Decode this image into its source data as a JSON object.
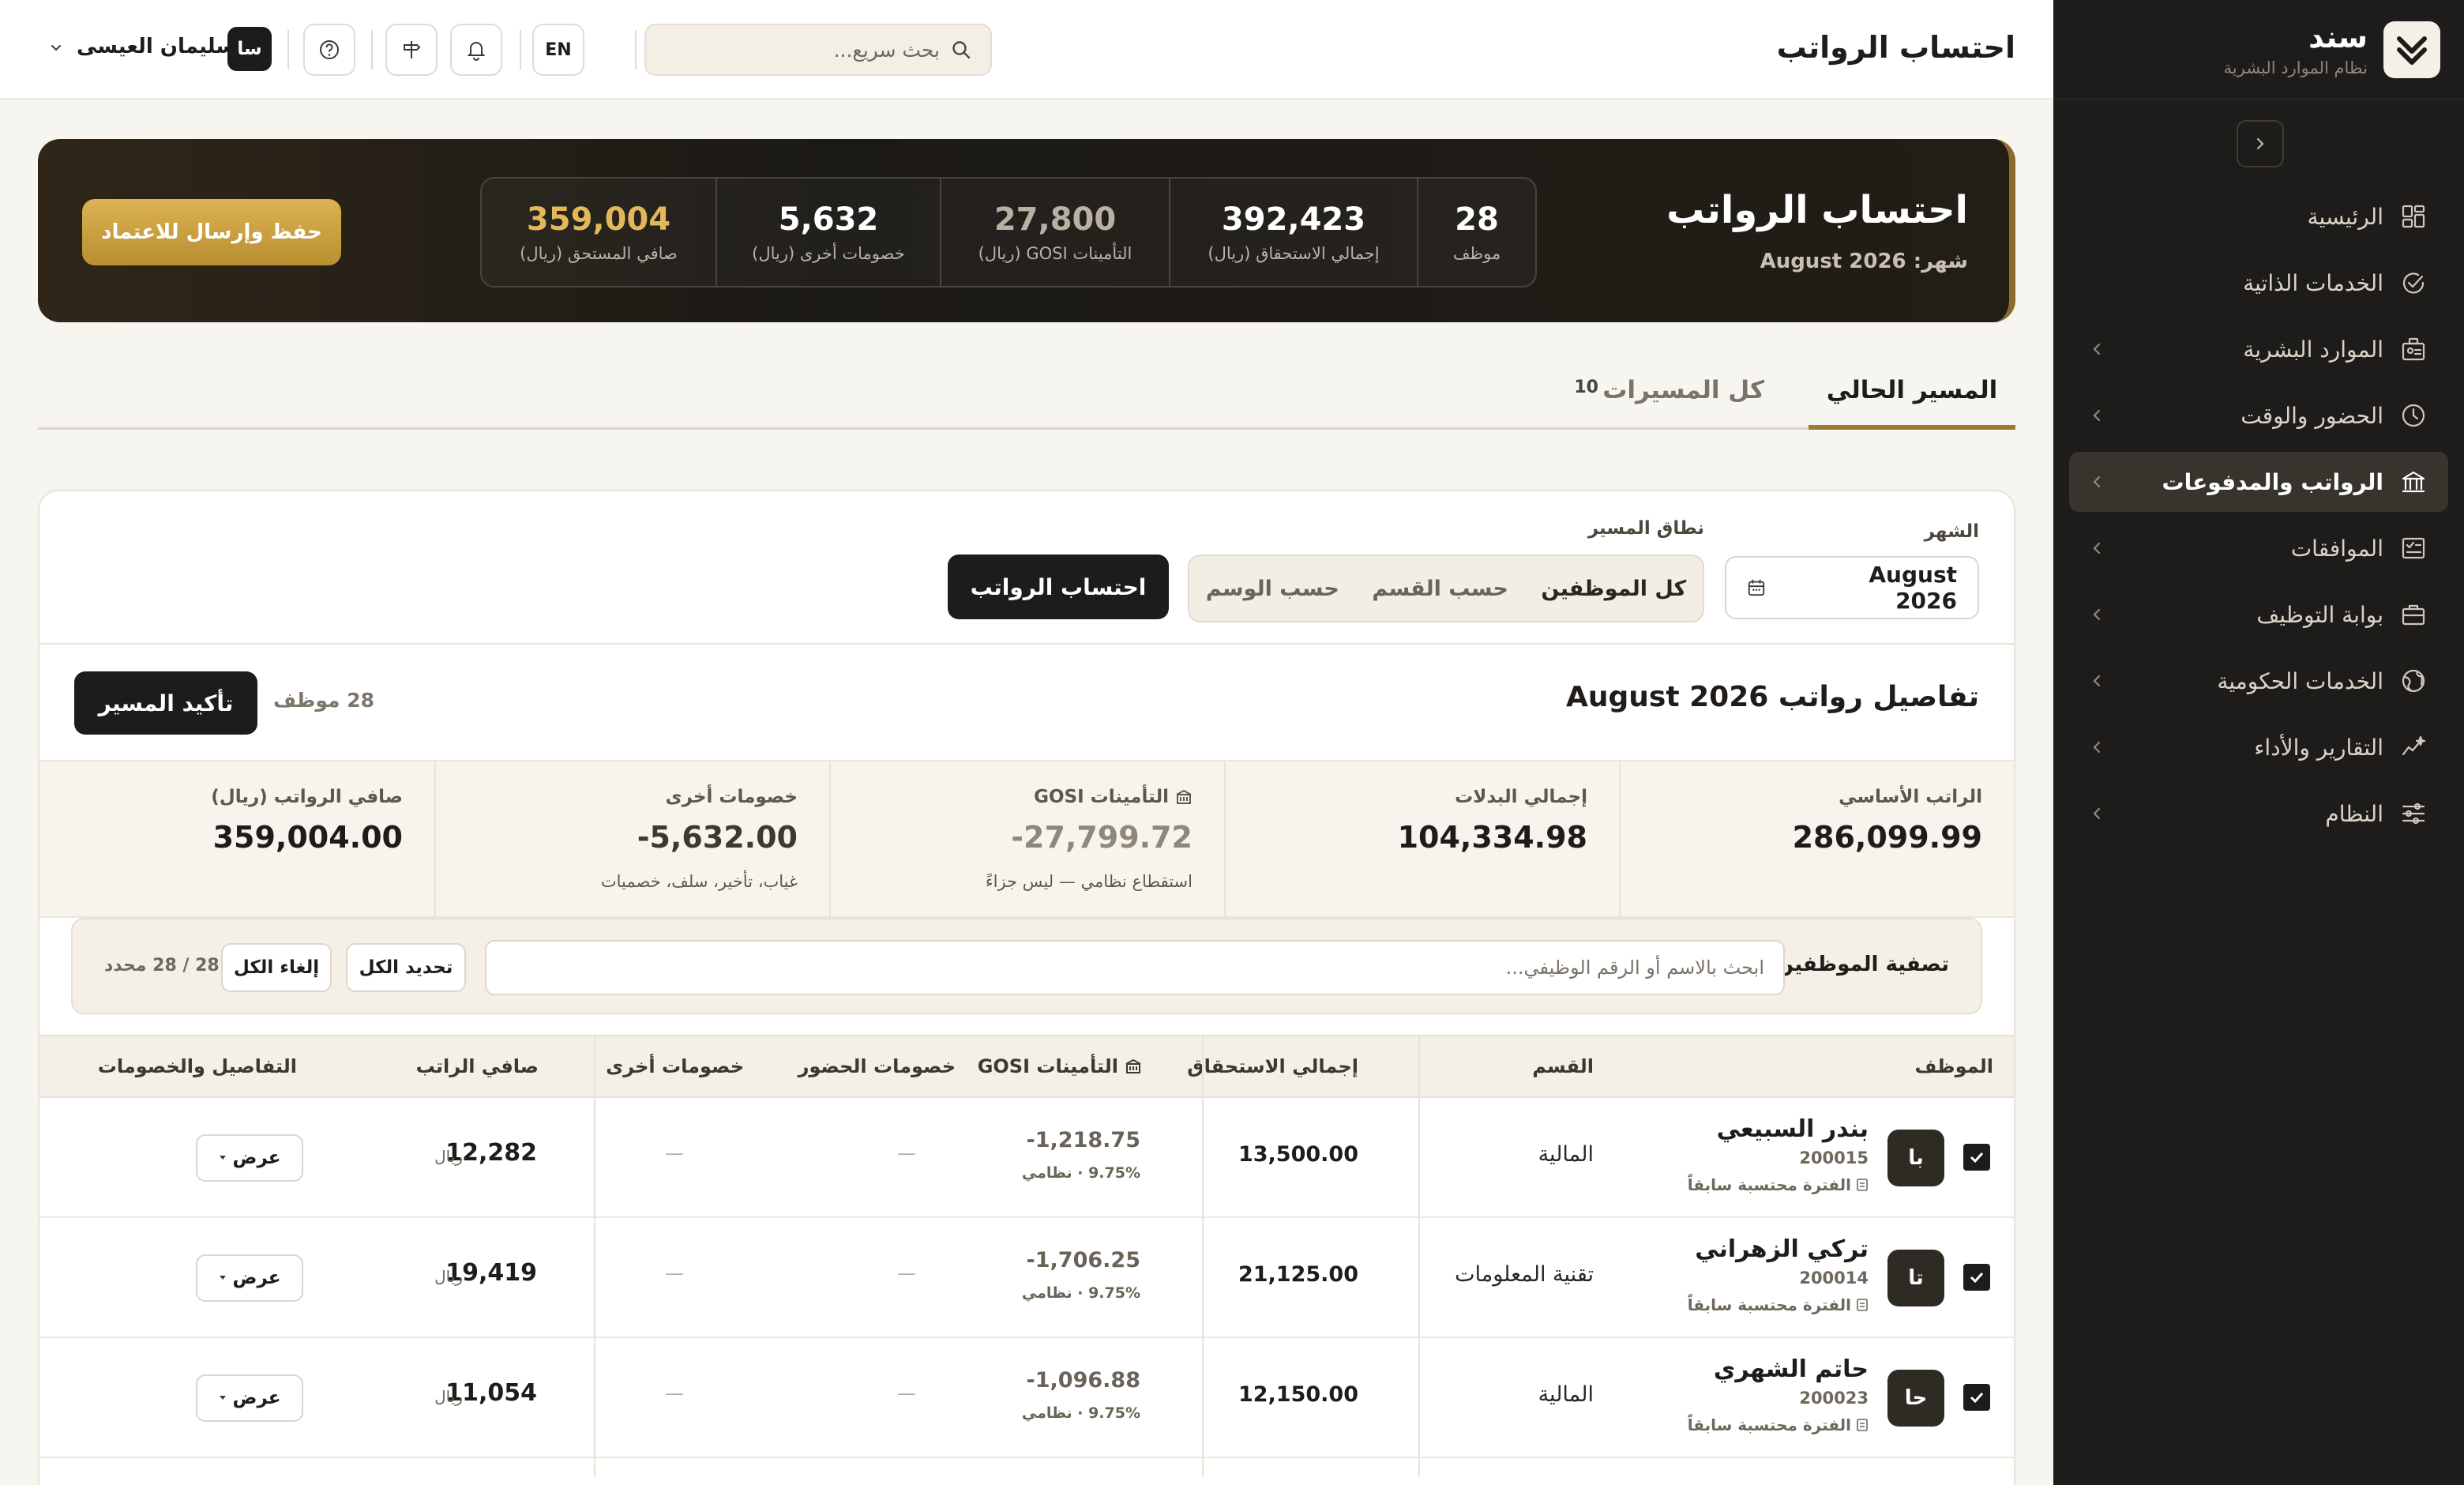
{
  "brand": {
    "name": "سند",
    "subtitle": "نظام الموارد البشرية"
  },
  "nav": [
    {
      "label": "الرئيسية",
      "icon": "dashboard-icon",
      "chevron": false,
      "active": false
    },
    {
      "label": "الخدمات الذاتية",
      "icon": "self-service-icon",
      "chevron": false,
      "active": false
    },
    {
      "label": "الموارد البشرية",
      "icon": "hr-icon",
      "chevron": true,
      "active": false
    },
    {
      "label": "الحضور والوقت",
      "icon": "clock-icon",
      "chevron": true,
      "active": false
    },
    {
      "label": "الرواتب والمدفوعات",
      "icon": "bank-icon",
      "chevron": true,
      "active": true
    },
    {
      "label": "الموافقات",
      "icon": "approvals-icon",
      "chevron": true,
      "active": false
    },
    {
      "label": "بوابة التوظيف",
      "icon": "briefcase-icon",
      "chevron": true,
      "active": false
    },
    {
      "label": "الخدمات الحكومية",
      "icon": "globe-icon",
      "chevron": true,
      "active": false
    },
    {
      "label": "التقارير والأداء",
      "icon": "chart-icon",
      "chevron": true,
      "active": false
    },
    {
      "label": "النظام",
      "icon": "settings-sliders-icon",
      "chevron": true,
      "active": false
    }
  ],
  "topbar": {
    "title": "احتساب الرواتب",
    "search_placeholder": "بحث سريع...",
    "lang": "EN",
    "user_initials": "سا",
    "user_name": "سليمان العيسى"
  },
  "hero": {
    "title": "احتساب الرواتب",
    "subtitle": "شهر: August 2026",
    "stats": [
      {
        "value": "28",
        "label": "موظف",
        "style": ""
      },
      {
        "value": "392,423",
        "label": "إجمالي الاستحقاق (ريال)",
        "style": ""
      },
      {
        "value": "27,800",
        "label": "التأمينات GOSI (ريال)",
        "style": "muted"
      },
      {
        "value": "5,632",
        "label": "خصومات أخرى (ريال)",
        "style": ""
      },
      {
        "value": "359,004",
        "label": "صافي المستحق (ريال)",
        "style": "gold"
      }
    ],
    "action": "حفظ وإرسال للاعتماد"
  },
  "tabs": {
    "current": "المسير الحالي",
    "all": "كل المسيرات",
    "all_count": "10"
  },
  "params": {
    "month_label": "الشهر",
    "month_value": "August  2026",
    "scope_label": "نطاق المسير",
    "scope_options": [
      "كل الموظفين",
      "حسب القسم",
      "حسب الوسم"
    ],
    "calculate": "احتساب الرواتب"
  },
  "details": {
    "title": "تفاصيل رواتب August 2026",
    "count": "28 موظف",
    "confirm": "تأكيد المسير",
    "summary": [
      {
        "label": "الراتب الأساسي",
        "value": "286,099.99",
        "note": "",
        "style": "",
        "icon": false
      },
      {
        "label": "إجمالي البدلات",
        "value": "104,334.98",
        "note": "",
        "style": "",
        "icon": false
      },
      {
        "label": "التأمينات GOSI",
        "value": "-27,799.72",
        "note": "استقطاع نظامي — ليس جزاءً",
        "style": "muted",
        "icon": true
      },
      {
        "label": "خصومات أخرى",
        "value": "-5,632.00",
        "note": "غياب، تأخير، سلف، خصميات",
        "style": "neg",
        "icon": false
      },
      {
        "label": "صافي الرواتب (ريال)",
        "value": "359,004.00",
        "note": "",
        "style": "",
        "icon": false
      }
    ],
    "filter": {
      "label": "تصفية الموظفين:",
      "placeholder": "ابحث بالاسم أو الرقم الوظيفي...",
      "select_all": "تحديد الكل",
      "deselect_all": "إلغاء الكل",
      "selected": "28 / 28 محدد"
    },
    "columns": [
      "الموظف",
      "القسم",
      "إجمالي الاستحقاق",
      "التأمينات GOSI",
      "خصومات الحضور",
      "خصومات أخرى",
      "صافي الراتب",
      "التفاصيل والخصومات"
    ],
    "rows": [
      {
        "initials": "با",
        "name": "بندر السبيعي",
        "id": "200015",
        "flag": "الفترة محتسبة سابقاً",
        "dept": "المالية",
        "gross": "13,500.00",
        "gosi": "-1,218.75",
        "gosi_note": "9.75% · نظامي",
        "att": "—",
        "other": "—",
        "net": "12,282",
        "currency": "ريال",
        "view": "عرض"
      },
      {
        "initials": "تا",
        "name": "تركي الزهراني",
        "id": "200014",
        "flag": "الفترة محتسبة سابقاً",
        "dept": "تقنية المعلومات",
        "gross": "21,125.00",
        "gosi": "-1,706.25",
        "gosi_note": "9.75% · نظامي",
        "att": "—",
        "other": "—",
        "net": "19,419",
        "currency": "ريال",
        "view": "عرض"
      },
      {
        "initials": "حا",
        "name": "حاتم الشهري",
        "id": "200023",
        "flag": "الفترة محتسبة سابقاً",
        "dept": "المالية",
        "gross": "12,150.00",
        "gosi": "-1,096.88",
        "gosi_note": "9.75% · نظامي",
        "att": "—",
        "other": "—",
        "net": "11,054",
        "currency": "ريال",
        "view": "عرض"
      }
    ]
  }
}
